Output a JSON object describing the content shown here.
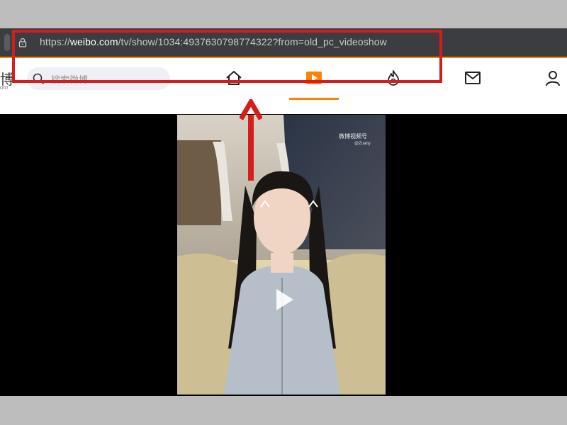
{
  "browser": {
    "url_prefix": "https://",
    "url_domain": "weibo.com",
    "url_path": "/tv/show/1034:4937630798774322?from=old_pc_videoshow"
  },
  "navbar": {
    "logo_text": "博",
    "logo_sub": "om",
    "search_placeholder": "搜索微博",
    "items": [
      {
        "icon": "home-icon"
      },
      {
        "icon": "video-icon",
        "active": true
      },
      {
        "icon": "hot-flame-icon"
      },
      {
        "icon": "mail-icon"
      },
      {
        "icon": "user-icon"
      }
    ]
  },
  "video": {
    "watermark": "微博视频号",
    "watermark_sub": "@Zuany",
    "state": "paused"
  },
  "annotation": {
    "color": "#d41d1d",
    "accent": "#ff8200"
  }
}
